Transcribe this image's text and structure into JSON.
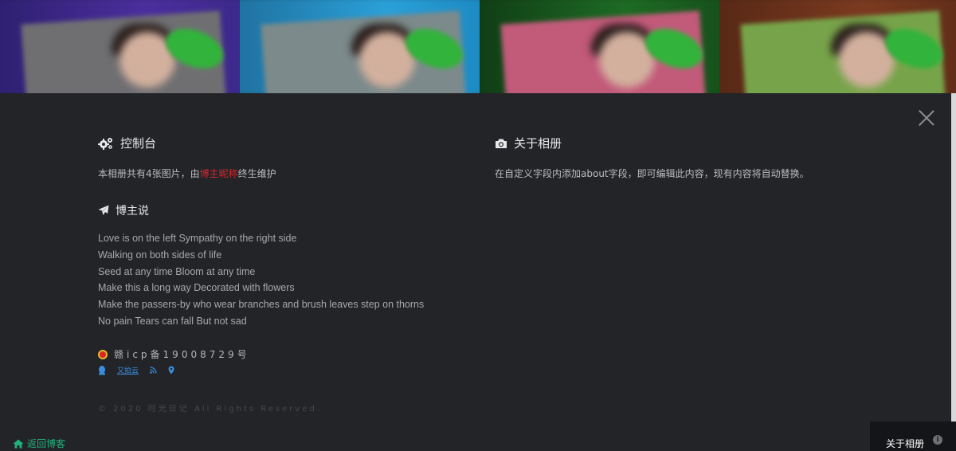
{
  "strip": {
    "photos": [
      {
        "name": "photo-1"
      },
      {
        "name": "photo-2"
      },
      {
        "name": "photo-3"
      },
      {
        "name": "photo-4"
      }
    ]
  },
  "console": {
    "icon": "gears-icon",
    "title": "控制台",
    "desc_prefix": "本相册共有4张图片，由",
    "owner": "博主昵称",
    "desc_suffix": "终生维护"
  },
  "about": {
    "icon": "camera-icon",
    "title": "关于相册",
    "desc": "在自定义字段内添加about字段，即可编辑此内容，现有内容将自动替换。"
  },
  "blogger": {
    "icon": "paper-plane-icon",
    "title": "博主说",
    "lines": [
      "Love is on the left Sympathy on the right side",
      "Walking on both sides of life",
      "Seed at any time Bloom at any time",
      "Make this a long way Decorated with flowers",
      "Make the passers-by who wear branches and brush leaves step on thorns",
      "No pain Tears can fall But not sad"
    ]
  },
  "icp": {
    "text": "赣icp备19008729号"
  },
  "links": {
    "qq_icon": "qq-icon",
    "cloud_label": "又拍云",
    "rss_icon": "rss-icon",
    "location_icon": "map-pin-icon"
  },
  "copyright": "© 2020 时光日记 All Rights Reserved.",
  "bottom": {
    "back_label": "返回博客",
    "about_label": "关于相册",
    "info_icon": "i"
  },
  "colors": {
    "accent_green": "#22b07a",
    "owner_red": "#d5262b",
    "link_blue": "#3a8dde",
    "panel_bg": "#222428"
  }
}
